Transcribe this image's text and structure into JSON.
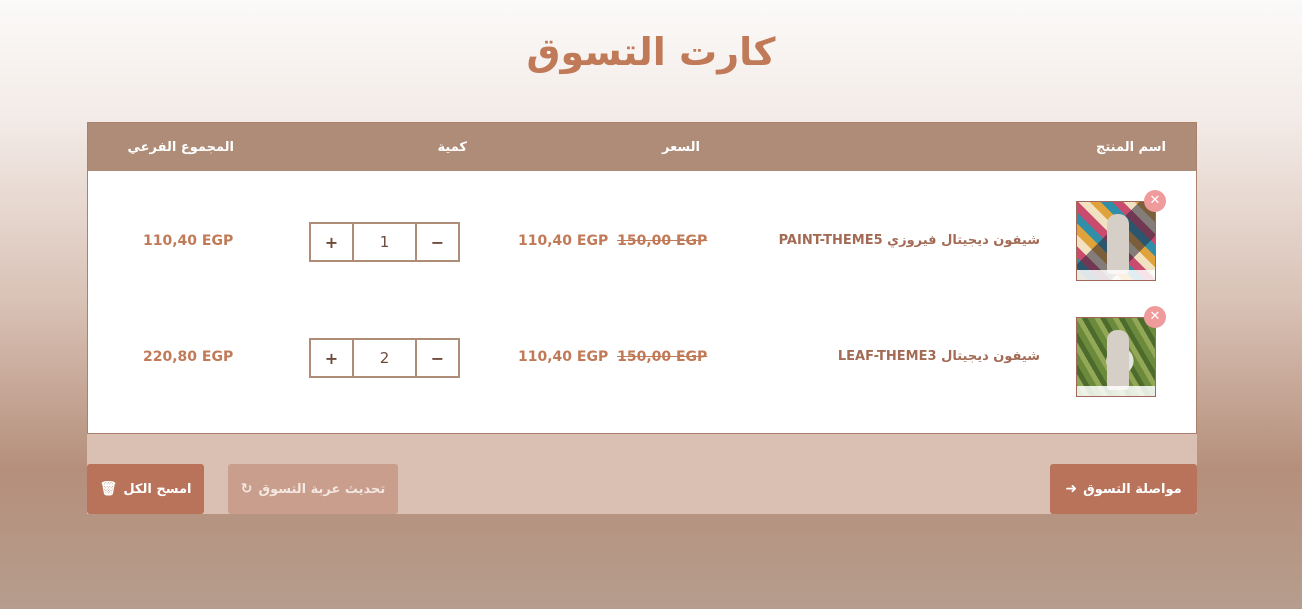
{
  "page": {
    "title": "كارت التسوق"
  },
  "table": {
    "headers": {
      "product": "اسم المنتج",
      "price": "السعر",
      "quantity": "كمية",
      "subtotal": "المجموع الفرعي"
    },
    "rows": [
      {
        "name": "شيفون ديجيتال فيروزي PAINT-THEME5",
        "price_current": "110,40 EGP",
        "price_old": "150,00 EGP",
        "quantity": "1",
        "subtotal": "110,40 EGP",
        "remove_icon": "close-icon"
      },
      {
        "name": "شيفون ديجيتال LEAF-THEME3",
        "price_current": "110,40 EGP",
        "price_old": "150,00 EGP",
        "quantity": "2",
        "subtotal": "220,80 EGP",
        "remove_icon": "close-icon"
      }
    ],
    "qty_controls": {
      "minus": "−",
      "plus": "+"
    }
  },
  "actions": {
    "continue_label": "مواصلة التسوق",
    "update_label": "تحديث عربة التسوق",
    "clear_label": "امسح الكل",
    "continue_icon": "arrow-left-icon",
    "update_icon": "refresh-icon",
    "clear_icon": "trash-icon"
  },
  "colors": {
    "accent": "#c17a58",
    "header_bg": "#ae8c78",
    "button_bg": "#b8735a",
    "remove_bg": "#ef9b9b"
  }
}
